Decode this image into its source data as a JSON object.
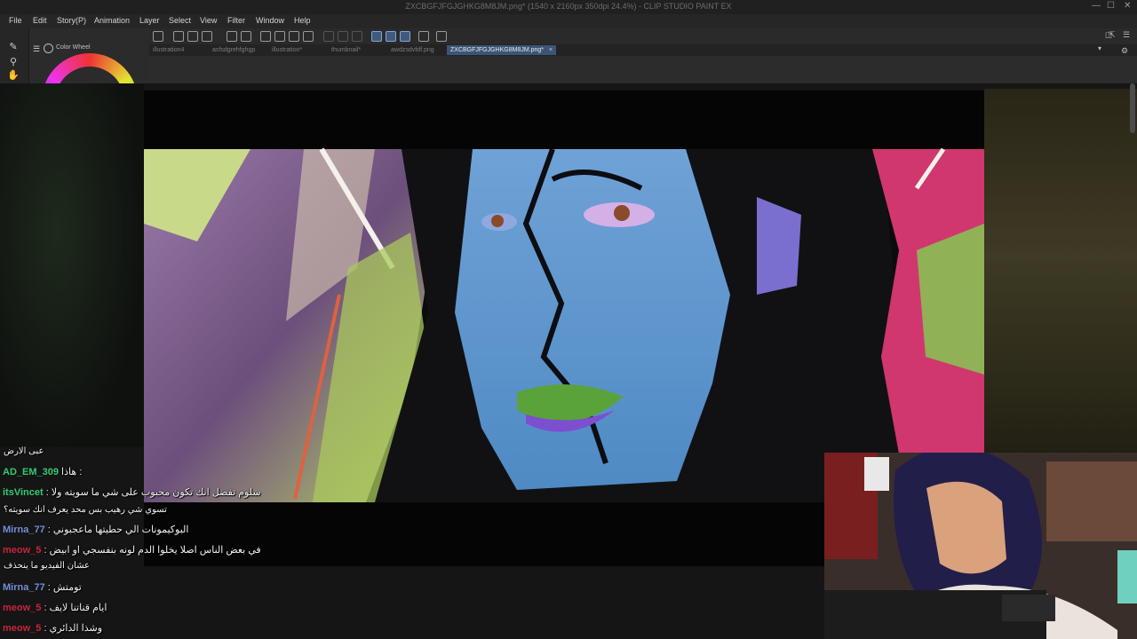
{
  "window": {
    "title": "ZXCBGFJFGJGHKG8M8JM.png* (1540 x 2160px 350dpi 24.4%) - CLIP STUDIO PAINT EX",
    "min": "—",
    "max": "☐",
    "close": "✕"
  },
  "menu": [
    "File",
    "Edit",
    "Story(P)",
    "Animation",
    "Layer",
    "Select",
    "View",
    "Filter",
    "Window",
    "Help"
  ],
  "panel": {
    "color_wheel_label": "Color Wheel"
  },
  "tabs": [
    {
      "label": "illustration4",
      "active": false
    },
    {
      "label": "asfsdgrehfghgp",
      "active": false
    },
    {
      "label": "illustration*",
      "active": false
    },
    {
      "label": "thumbnail*",
      "active": false
    },
    {
      "label": "awdzsdvfdf.png",
      "active": false
    },
    {
      "label": "ZXCBGFJFGJGHKG8M8JM.png*",
      "active": true
    }
  ],
  "tab_close": "×",
  "chat": [
    {
      "user": "",
      "message": "عبى الارض",
      "color": "#ffffff"
    },
    {
      "user": "AD_EM_309",
      "message": "هاذا :",
      "color": "#2ecc71"
    },
    {
      "user": "itsVincet",
      "message": ": سلوم تفضل انك تكون محبوب على شي ما سويته ولا",
      "color": "#2ecc71"
    },
    {
      "user": "",
      "message": "تسوي شي رهيب بس محد يعرف انك سويته؟",
      "color": "#ffffff"
    },
    {
      "user": "Mirna_77",
      "message": ": البوكيمونات الي حطيتها ماعجبوني",
      "color": "#6f8fd8"
    },
    {
      "user": "meow_5",
      "message": ": في بعض الناس اصلا يخلوا الدم لونه بنفسجي او ابيض",
      "color": "#c8243c"
    },
    {
      "user": "",
      "message": "عشان الفيديو ما ينحذف",
      "color": "#ffffff"
    },
    {
      "user": "Mirna_77",
      "message": ": تومتش",
      "color": "#6f8fd8"
    },
    {
      "user": "meow_5",
      "message": ": ايام قناتنا لايف",
      "color": "#c8243c"
    },
    {
      "user": "meow_5",
      "message": ": وشذا الدائري",
      "color": "#c8243c"
    }
  ]
}
